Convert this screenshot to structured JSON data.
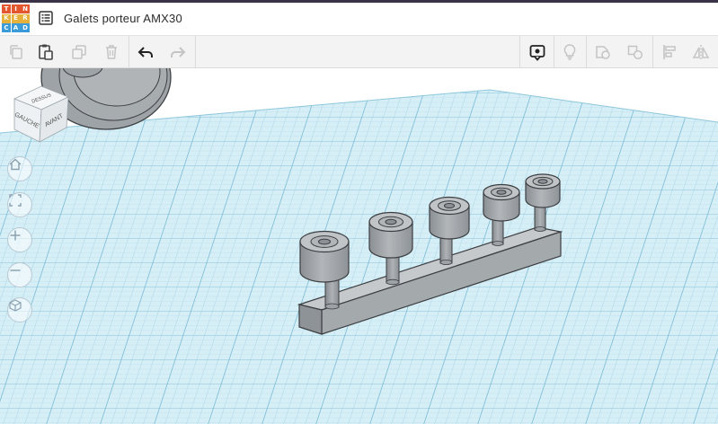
{
  "app": {
    "logo_letters": [
      "T",
      "I",
      "N",
      "K",
      "E",
      "R",
      "C",
      "A",
      "D"
    ],
    "logo_colors": [
      "#e4572e",
      "#e4572e",
      "#e4572e",
      "#e5b13a",
      "#e5b13a",
      "#e5b13a",
      "#3a9bd8",
      "#3a9bd8",
      "#3a9bd8"
    ],
    "title": "Galets porteur AMX30"
  },
  "toolbar": {
    "left": [
      {
        "name": "copy-icon",
        "enabled": false
      },
      {
        "name": "paste-icon",
        "enabled": true
      },
      {
        "name": "duplicate-icon",
        "enabled": false
      },
      {
        "name": "delete-icon",
        "enabled": false
      },
      {
        "name": "undo-icon",
        "enabled": true
      },
      {
        "name": "redo-icon",
        "enabled": false
      }
    ],
    "right": [
      {
        "name": "comment-icon",
        "enabled": true
      },
      {
        "name": "lightbulb-icon",
        "enabled": false
      },
      {
        "name": "group-icon",
        "enabled": false
      },
      {
        "name": "ungroup-icon",
        "enabled": false
      },
      {
        "name": "align-icon",
        "enabled": false
      },
      {
        "name": "mirror-icon",
        "enabled": false
      }
    ]
  },
  "view_cube": {
    "top": "DESSUS",
    "left": "GAUCHE",
    "front": "AVANT"
  },
  "nav_controls": [
    "home-view-icon",
    "fit-all-icon",
    "zoom-in-icon",
    "zoom-out-icon",
    "perspective-icon"
  ],
  "colors": {
    "grid_background": "#d6eef6",
    "grid_minor": "#a9d6e6",
    "grid_major": "#6fb6d2",
    "model_gray": "#9ea3a7",
    "model_outline": "#3c3f42"
  }
}
